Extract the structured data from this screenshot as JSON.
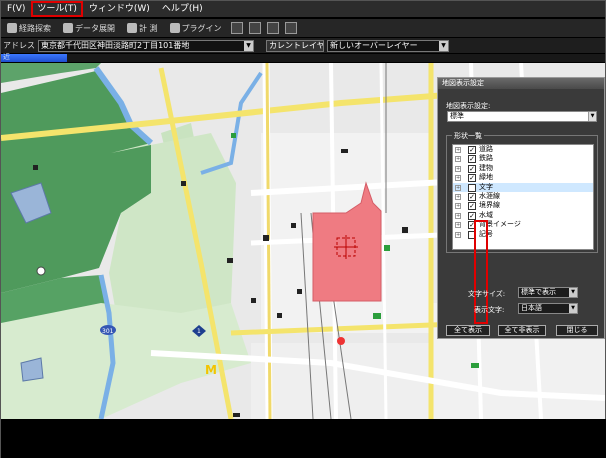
{
  "menu": {
    "file": "F(V)",
    "tool": "ツール(T)",
    "window": "ウィンドウ(W)",
    "help": "ヘルプ(H)"
  },
  "toolbar": {
    "route_search": "経路探索",
    "data_expand": "データ展開",
    "measure": "計 測",
    "plugin": "プラグイン"
  },
  "address": {
    "label": "アドレス",
    "value": "東京都千代田区神田淡路町2丁目101番地",
    "layer_label": "カレントレイヤー",
    "layer_value": "新しいオーバーレイヤー"
  },
  "progress": {
    "glyph": "近",
    "fraction": 0.11
  },
  "map": {
    "route_shields": [
      "301",
      "1"
    ]
  },
  "dialog": {
    "title": "地図表示設定",
    "display_setting_label": "地図表示設定:",
    "display_setting_value": "標準",
    "shape_list_label": "形状一覧",
    "items": [
      {
        "label": "道路",
        "checked": true,
        "selected": false
      },
      {
        "label": "鉄路",
        "checked": true,
        "selected": false
      },
      {
        "label": "建物",
        "checked": true,
        "selected": false
      },
      {
        "label": "緑地",
        "checked": true,
        "selected": false
      },
      {
        "label": "文字",
        "checked": false,
        "selected": true
      },
      {
        "label": "水涯線",
        "checked": true,
        "selected": false
      },
      {
        "label": "境界線",
        "checked": true,
        "selected": false
      },
      {
        "label": "水域",
        "checked": true,
        "selected": false
      },
      {
        "label": "背景イメージ",
        "checked": true,
        "selected": false
      },
      {
        "label": "記号",
        "checked": false,
        "selected": false
      }
    ],
    "text_size_label": "文字サイズ:",
    "text_size_value": "標準で表示",
    "display_text_label": "表示文字:",
    "display_text_value": "日本語",
    "show_all": "全て表示",
    "hide_all": "全て非表示",
    "close": "閉じる"
  }
}
